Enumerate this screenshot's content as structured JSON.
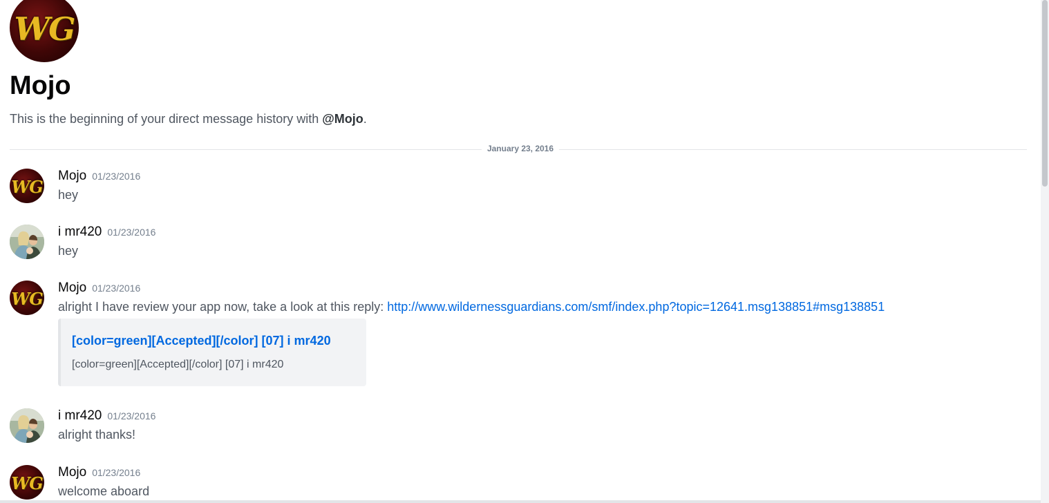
{
  "channel": {
    "title": "Mojo",
    "intro_prefix": "This is the beginning of your direct message history with ",
    "intro_mention": "@Mojo",
    "intro_suffix": ".",
    "avatar_text": "WG"
  },
  "divider": {
    "date": "January 23, 2016"
  },
  "messages": [
    {
      "author": "Mojo",
      "timestamp": "01/23/2016",
      "text": "hey",
      "avatar": "wg-logo",
      "avatar_text": "WG"
    },
    {
      "author": "i mr420",
      "timestamp": "01/23/2016",
      "text": "hey",
      "avatar": "user-photo"
    },
    {
      "author": "Mojo",
      "timestamp": "01/23/2016",
      "text": "alright I have review your app now, take a look at this reply: ",
      "link": "http://www.wildernessguardians.com/smf/index.php?topic=12641.msg138851#msg138851",
      "avatar": "wg-logo",
      "avatar_text": "WG",
      "embed": {
        "title": "[color=green][Accepted][/color]  [07] i mr420",
        "description": "[color=green][Accepted][/color] [07] i mr420"
      }
    },
    {
      "author": "i mr420",
      "timestamp": "01/23/2016",
      "text": "alright thanks!",
      "avatar": "user-photo"
    },
    {
      "author": "Mojo",
      "timestamp": "01/23/2016",
      "text": "welcome aboard",
      "avatar": "wg-logo",
      "avatar_text": "WG"
    }
  ],
  "colors": {
    "link": "#0068e0",
    "text": "#4f5660",
    "author": "#060607",
    "muted": "#747f8d"
  }
}
